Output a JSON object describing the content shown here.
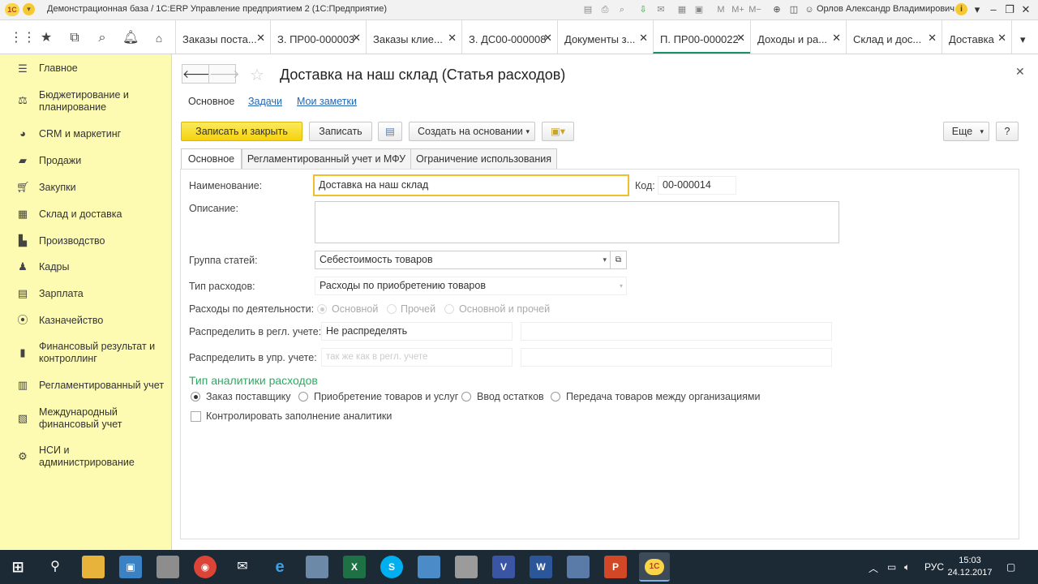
{
  "window": {
    "title": "Демонстрационная база / 1С:ERP Управление предприятием 2  (1С:Предприятие)",
    "user": "Орлов Александр Владимирович",
    "logo_text": "1С"
  },
  "tabs": [
    {
      "label": "Заказы поста..."
    },
    {
      "label": "З. ПР00-000003"
    },
    {
      "label": "Заказы клие..."
    },
    {
      "label": "З. ДС00-000008"
    },
    {
      "label": "Документы з..."
    },
    {
      "label": "П. ПР00-000022"
    },
    {
      "label": "Доходы и ра..."
    },
    {
      "label": "Склад и дос..."
    },
    {
      "label": "Доставка"
    }
  ],
  "sidebar": {
    "items": [
      {
        "label": "Главное",
        "icon": "menu-icon"
      },
      {
        "label": "Бюджетирование и планирование",
        "icon": "budget-icon"
      },
      {
        "label": "CRM и маркетинг",
        "icon": "crm-icon"
      },
      {
        "label": "Продажи",
        "icon": "sales-icon"
      },
      {
        "label": "Закупки",
        "icon": "cart-icon"
      },
      {
        "label": "Склад и доставка",
        "icon": "warehouse-icon"
      },
      {
        "label": "Производство",
        "icon": "production-icon"
      },
      {
        "label": "Кадры",
        "icon": "staff-icon"
      },
      {
        "label": "Зарплата",
        "icon": "salary-icon"
      },
      {
        "label": "Казначейство",
        "icon": "treasury-icon"
      },
      {
        "label": "Финансовый результат и контроллинг",
        "icon": "finance-icon"
      },
      {
        "label": "Регламентированный учет",
        "icon": "accounting-icon"
      },
      {
        "label": "Международный финансовый учет",
        "icon": "international-icon"
      },
      {
        "label": "НСИ и администрирование",
        "icon": "gear-icon"
      }
    ]
  },
  "form": {
    "title": "Доставка на наш склад (Статья расходов)",
    "nav_links": {
      "main": "Основное",
      "tasks": "Задачи",
      "notes": "Мои заметки"
    },
    "toolbar": {
      "save_close": "Записать и закрыть",
      "save": "Записать",
      "create_based": "Создать на основании",
      "more": "Еще",
      "help": "?"
    },
    "form_tabs": [
      "Основное",
      "Регламентированный учет и МФУ",
      "Ограничение использования"
    ],
    "fields": {
      "name_label": "Наименование:",
      "name_value": "Доставка на наш склад",
      "code_label": "Код:",
      "code_value": "00-000014",
      "description_label": "Описание:",
      "group_label": "Группа статей:",
      "group_value": "Себестоимость товаров",
      "expense_type_label": "Тип расходов:",
      "expense_type_value": "Расходы по приобретению товаров",
      "activity_label": "Расходы по деятельности:",
      "activity_options": [
        "Основной",
        "Прочей",
        "Основной и прочей"
      ],
      "distribute_reg_label": "Распределить в регл. учете:",
      "distribute_reg_value": "Не распределять",
      "distribute_mgmt_label": "Распределить в упр. учете:",
      "distribute_mgmt_placeholder": "так же как в регл. учете"
    },
    "analytics": {
      "section_title": "Тип аналитики расходов",
      "options": [
        "Заказ поставщику",
        "Приобретение товаров и услуг",
        "Ввод остатков",
        "Передача товаров между организациями"
      ],
      "selected": "Заказ поставщику",
      "checkbox_label": "Контролировать заполнение аналитики"
    }
  },
  "taskbar": {
    "time": "15:03",
    "date": "24.12.2017",
    "lang": "РУС"
  },
  "colors": {
    "sidebar_bg": "#fdfbb1",
    "primary_button": "#f5d20e",
    "link": "#2466b0",
    "section": "#2bab61",
    "active_tab_underline": "#1a8f6a"
  }
}
